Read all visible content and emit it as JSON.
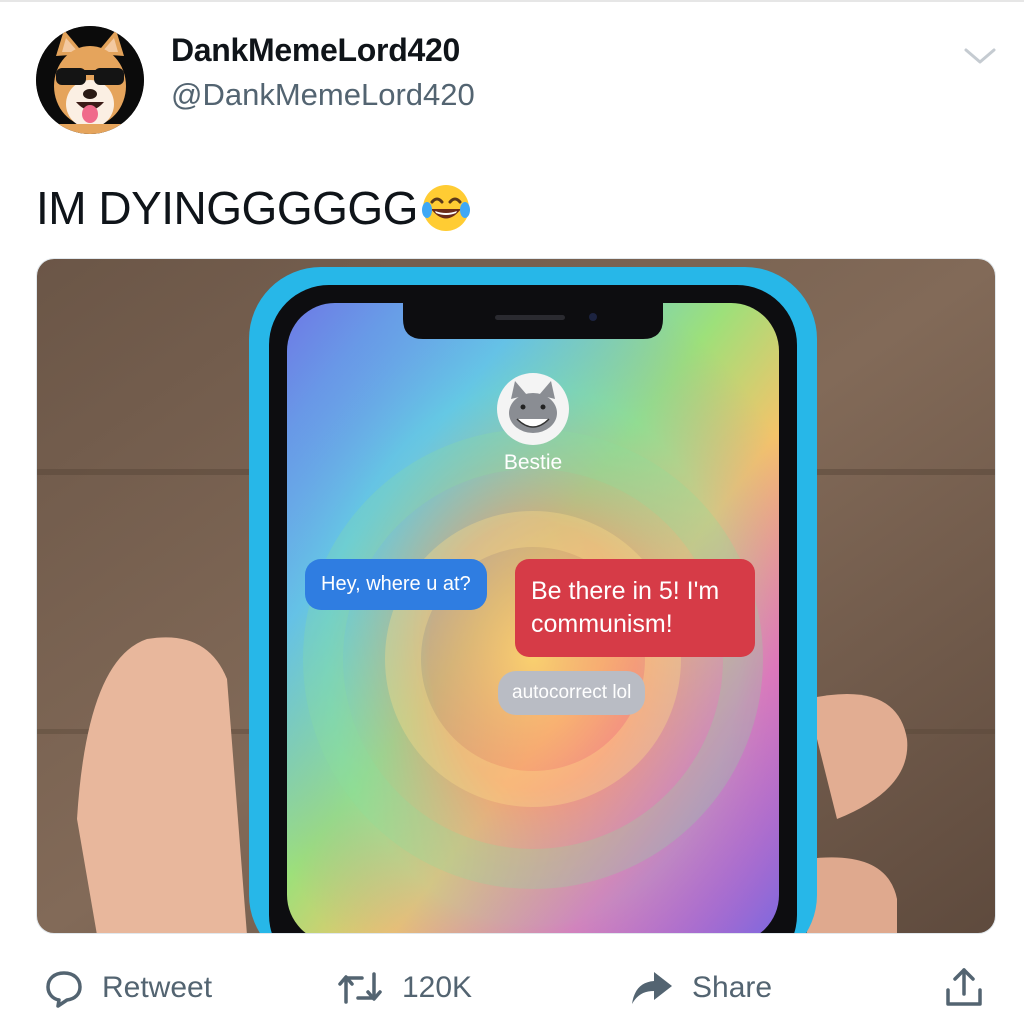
{
  "author": {
    "name": "DankMemeLord420",
    "handle": "@DankMemeLord420"
  },
  "tweet": {
    "text": "IM DYINGGGGGG"
  },
  "media": {
    "contact": {
      "name": "Bestie"
    },
    "messages": [
      {
        "text": "Hey, where u at?",
        "color": "#2f7de1"
      },
      {
        "text_line1": "Be there in 5! I'm",
        "text_line2": "communism!",
        "color": "#d63b47"
      },
      {
        "text": "autocorrect lol",
        "color": "#b9bcc4"
      }
    ],
    "phone_case_color": "#27b7e8"
  },
  "actions": {
    "reply_label": "Retweet",
    "retweet_count": "120K",
    "share_label": "Share"
  },
  "colors": {
    "text": "#0f1419",
    "muted": "#536471"
  }
}
